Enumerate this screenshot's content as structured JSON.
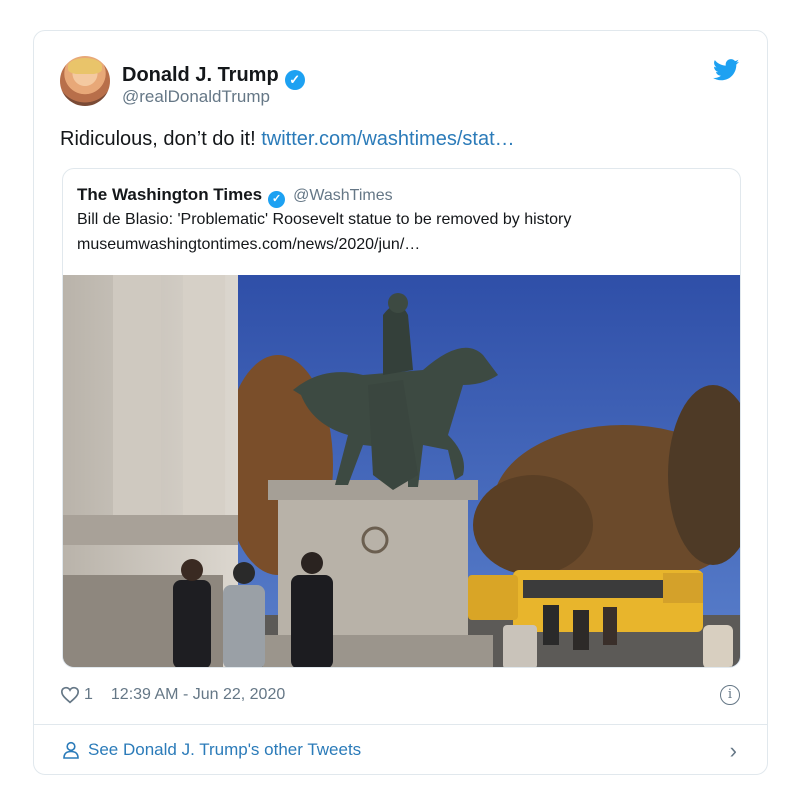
{
  "author": {
    "name": "Donald J. Trump",
    "handle": "@realDonaldTrump",
    "verified_icon": "verified-check-icon"
  },
  "tweet": {
    "text": "Ridiculous, don’t do it!",
    "link": "twitter.com/washtimes/stat…"
  },
  "quote": {
    "name": "The Washington Times",
    "handle": "@WashTimes",
    "line1": "Bill de Blasio: 'Problematic' Roosevelt statue to be removed by history",
    "line2": "museumwashingtontimes.com/news/2020/jun/…"
  },
  "meta": {
    "like_count": "1",
    "timestamp": "12:39 AM - Jun 22, 2020"
  },
  "footer": {
    "label": "See Donald J. Trump's other Tweets"
  },
  "colors": {
    "link": "#2b7bb9",
    "twitter_blue": "#1da1f2",
    "secondary_text": "#657786",
    "border": "#e1e8ed"
  }
}
